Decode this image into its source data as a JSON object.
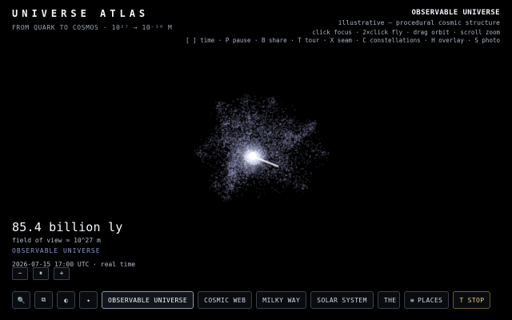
{
  "app": {
    "title": "UNIVERSE ATLAS",
    "subtitle": "FROM QUARK TO COSMOS · 10²⁷ → 10⁻¹⁸ M"
  },
  "info_panel": {
    "title": "OBSERVABLE UNIVERSE",
    "description": "illustrative — procedural cosmic structure",
    "controls_hint": "click focus · 2×click fly · drag orbit · scroll zoom",
    "shortcuts_hint": "[ ] time · P pause · B share · T tour · X seam · C constellations · H overlay · S photo"
  },
  "scale": {
    "distance": "85.4 billion ly",
    "field_of_view": "field of view ≈ 10^27 m",
    "level_name": "OBSERVABLE UNIVERSE",
    "timestamp": "2026-07-15 17:00 UTC · real time"
  },
  "time_controls": [
    {
      "label": "−"
    },
    {
      "label": "⏸"
    },
    {
      "label": "+"
    }
  ],
  "toolbar": {
    "tools": [
      {
        "icon": "search-icon",
        "glyph": "🔍"
      },
      {
        "icon": "copy-icon",
        "glyph": "⧉"
      },
      {
        "icon": "contrast-icon",
        "glyph": "◐"
      },
      {
        "icon": "sparkle-icon",
        "glyph": "✦"
      }
    ],
    "levels": [
      {
        "label": "OBSERVABLE UNIVERSE"
      },
      {
        "label": "COSMIC WEB"
      },
      {
        "label": "MILKY WAY"
      },
      {
        "label": "SOLAR SYSTEM"
      },
      {
        "label": "THE"
      }
    ],
    "places": {
      "icon": "≡",
      "label": "PLACES"
    },
    "tour": {
      "key": "T",
      "label": "STOP"
    }
  },
  "colors": {
    "background": "#000000",
    "accent_blue": "#8a97c4",
    "tour_gold": "#e2c98a"
  }
}
